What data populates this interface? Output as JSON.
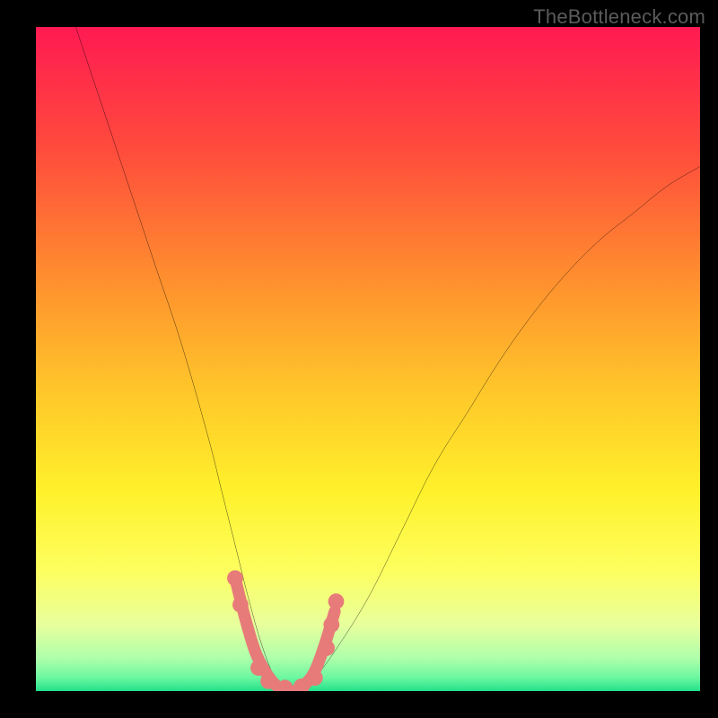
{
  "watermark": "TheBottleneck.com",
  "gradient": {
    "stops": [
      {
        "offset": 0.0,
        "color": "#ff1a52"
      },
      {
        "offset": 0.18,
        "color": "#ff4a3d"
      },
      {
        "offset": 0.38,
        "color": "#ff8f2e"
      },
      {
        "offset": 0.55,
        "color": "#ffc72a"
      },
      {
        "offset": 0.7,
        "color": "#fff12b"
      },
      {
        "offset": 0.82,
        "color": "#fdff60"
      },
      {
        "offset": 0.9,
        "color": "#e8ff9c"
      },
      {
        "offset": 0.95,
        "color": "#afffab"
      },
      {
        "offset": 0.98,
        "color": "#6cf7a0"
      },
      {
        "offset": 1.0,
        "color": "#23e08a"
      }
    ]
  },
  "chart_data": {
    "type": "line",
    "title": "",
    "xlabel": "",
    "ylabel": "",
    "xlim": [
      0,
      100
    ],
    "ylim": [
      0,
      100
    ],
    "series": [
      {
        "name": "bottleneck-curve",
        "color": "#000000",
        "x": [
          6,
          10,
          14,
          18,
          22,
          26,
          28,
          30,
          32,
          34,
          36,
          38,
          40,
          42,
          45,
          50,
          55,
          60,
          65,
          70,
          75,
          80,
          85,
          90,
          95,
          100
        ],
        "y": [
          100,
          88,
          76,
          64,
          52,
          38,
          30,
          22,
          14,
          7,
          2,
          0,
          0,
          2,
          6,
          14,
          24,
          34,
          42,
          50,
          57,
          63,
          68,
          72,
          76,
          79
        ]
      },
      {
        "name": "highlight-band",
        "color": "#e77b79",
        "x": [
          30,
          31.5,
          33,
          34.5,
          36,
          37.5,
          39,
          40.5,
          42,
          43.5,
          45
        ],
        "y": [
          17,
          11,
          6,
          3,
          1,
          0,
          0,
          1,
          3,
          7,
          12
        ]
      }
    ],
    "highlight_dots": {
      "name": "highlight-dots",
      "color": "#e77b79",
      "radius_pct": 1.2,
      "points": [
        {
          "x": 30.0,
          "y": 17
        },
        {
          "x": 30.8,
          "y": 13
        },
        {
          "x": 33.5,
          "y": 3.5
        },
        {
          "x": 35.0,
          "y": 1.5
        },
        {
          "x": 37.5,
          "y": 0.5
        },
        {
          "x": 40.0,
          "y": 0.7
        },
        {
          "x": 42.0,
          "y": 2.0
        },
        {
          "x": 43.8,
          "y": 6.5
        },
        {
          "x": 44.5,
          "y": 10.0
        },
        {
          "x": 45.2,
          "y": 13.5
        }
      ]
    }
  }
}
